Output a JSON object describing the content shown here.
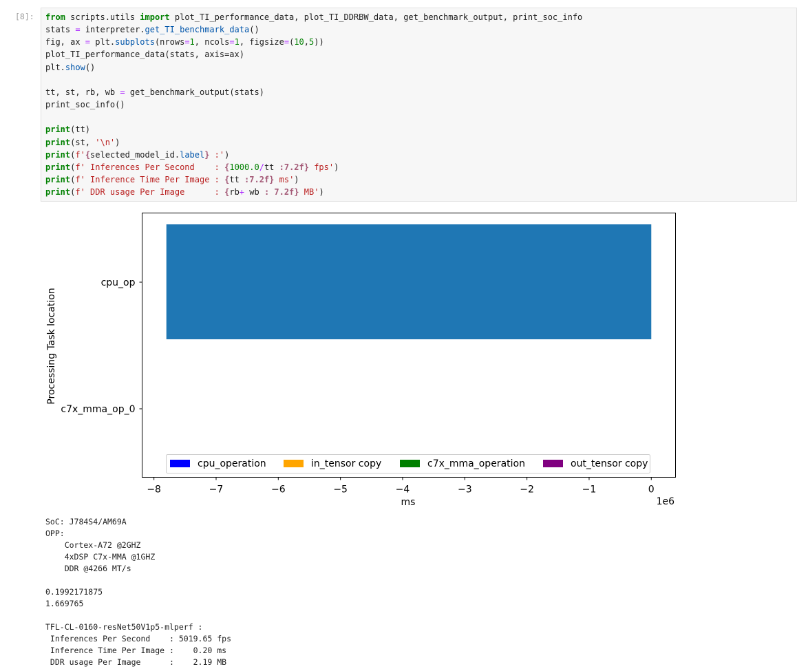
{
  "cell": {
    "prompt": "[8]:"
  },
  "code": {
    "l1": {
      "from": "from",
      "mod": " scripts.utils ",
      "imp": "import",
      "rest": " plot_TI_performance_data, plot_TI_DDRBW_data, get_benchmark_output, print_soc_info"
    },
    "l2": {
      "a": "stats ",
      "eq": "=",
      "b": " interpreter.",
      "fn": "get_TI_benchmark_data",
      "c": "()"
    },
    "l3": {
      "a": "fig, ax ",
      "eq": "=",
      "b": " plt.",
      "fn": "subplots",
      "c": "(nrows",
      "eq2": "=",
      "n1": "1",
      "d": ", ncols",
      "eq3": "=",
      "n2": "1",
      "e": ", figsize",
      "eq4": "=",
      "f": "(",
      "n3": "10",
      "g": ",",
      "n4": "5",
      "h": "))"
    },
    "l4": "plot_TI_performance_data(stats, axis=ax)",
    "l5": {
      "a": "plt.",
      "fn": "show",
      "c": "()"
    },
    "l6": {
      "a": "tt, st, rb, wb ",
      "eq": "=",
      "b": " get_benchmark_output(stats)"
    },
    "l7": "print_soc_info()",
    "l8": {
      "fn": "print",
      "c": "(tt)"
    },
    "l9": {
      "fn": "print",
      "c": "(st, ",
      "s": "'\\n'",
      "d": ")"
    },
    "l10": {
      "fn": "print",
      "a": "(",
      "s1": "f'",
      "b1": "{",
      "v": "selected_model_id.",
      "attr": "label",
      "b2": "}",
      "s2": " :'",
      "c": ")"
    },
    "l11": {
      "fn": "print",
      "a": "(",
      "s1": "f' Inferences Per Second    : ",
      "b1": "{",
      "n": "1000.0",
      "op": "/",
      "v": "tt ",
      "f": ":7.2f",
      "b2": "}",
      "s2": " fps'",
      "c": ")"
    },
    "l12": {
      "fn": "print",
      "a": "(",
      "s1": "f' Inference Time Per Image : ",
      "b1": "{",
      "v": "tt ",
      "f": ":7.2f",
      "b2": "}",
      "s2": " ms'",
      "c": ")"
    },
    "l13": {
      "fn": "print",
      "a": "(",
      "s1": "f' DDR usage Per Image      : ",
      "b1": "{",
      "v1": "rb",
      "op": "+",
      "v2": " wb ",
      "f": ": 7.2f",
      "b2": "}",
      "s2": " MB'",
      "c": ")"
    }
  },
  "chart_data": {
    "type": "bar",
    "orientation": "horizontal",
    "categories": [
      "cpu_op",
      "c7x_mma_op_0"
    ],
    "series": [
      {
        "name": "cpu_operation",
        "color": "#0000ff",
        "values": [
          -7800000,
          0
        ]
      },
      {
        "name": "in_tensor copy",
        "color": "#ffa500",
        "values": [
          0,
          0
        ]
      },
      {
        "name": "c7x_mma_operation",
        "color": "#008000",
        "values": [
          0,
          0
        ]
      },
      {
        "name": "out_tensor copy",
        "color": "#800080",
        "values": [
          0,
          0
        ]
      }
    ],
    "bar_color": "#1f77b4",
    "bar_span": [
      -7800000,
      0
    ],
    "xlabel": "ms",
    "ylabel": "Processing Task location",
    "x_scale_label": "1e6",
    "xlim": [
      -8190000,
      390000
    ],
    "xticks": [
      -8,
      -7,
      -6,
      -5,
      -4,
      -3,
      -2,
      -1,
      0
    ],
    "xtick_labels": [
      "−8",
      "−7",
      "−6",
      "−5",
      "−4",
      "−3",
      "−2",
      "−1",
      "0"
    ],
    "legend_position": "bottom-center",
    "grid": false
  },
  "output": {
    "soc": "SoC: J784S4/AM69A",
    "opp": "OPP:",
    "cpu": "    Cortex-A72 @2GHZ",
    "dsp": "    4xDSP C7x-MMA @1GHZ",
    "ddr": "    DDR @4266 MT/s",
    "tt": "0.1992171875",
    "st": "1.669765",
    "model": "TFL-CL-0160-resNet50V1p5-mlperf :",
    "fps": " Inferences Per Second    : 5019.65 fps",
    "ms": " Inference Time Per Image :    0.20 ms",
    "mb": " DDR usage Per Image      :    2.19 MB"
  }
}
